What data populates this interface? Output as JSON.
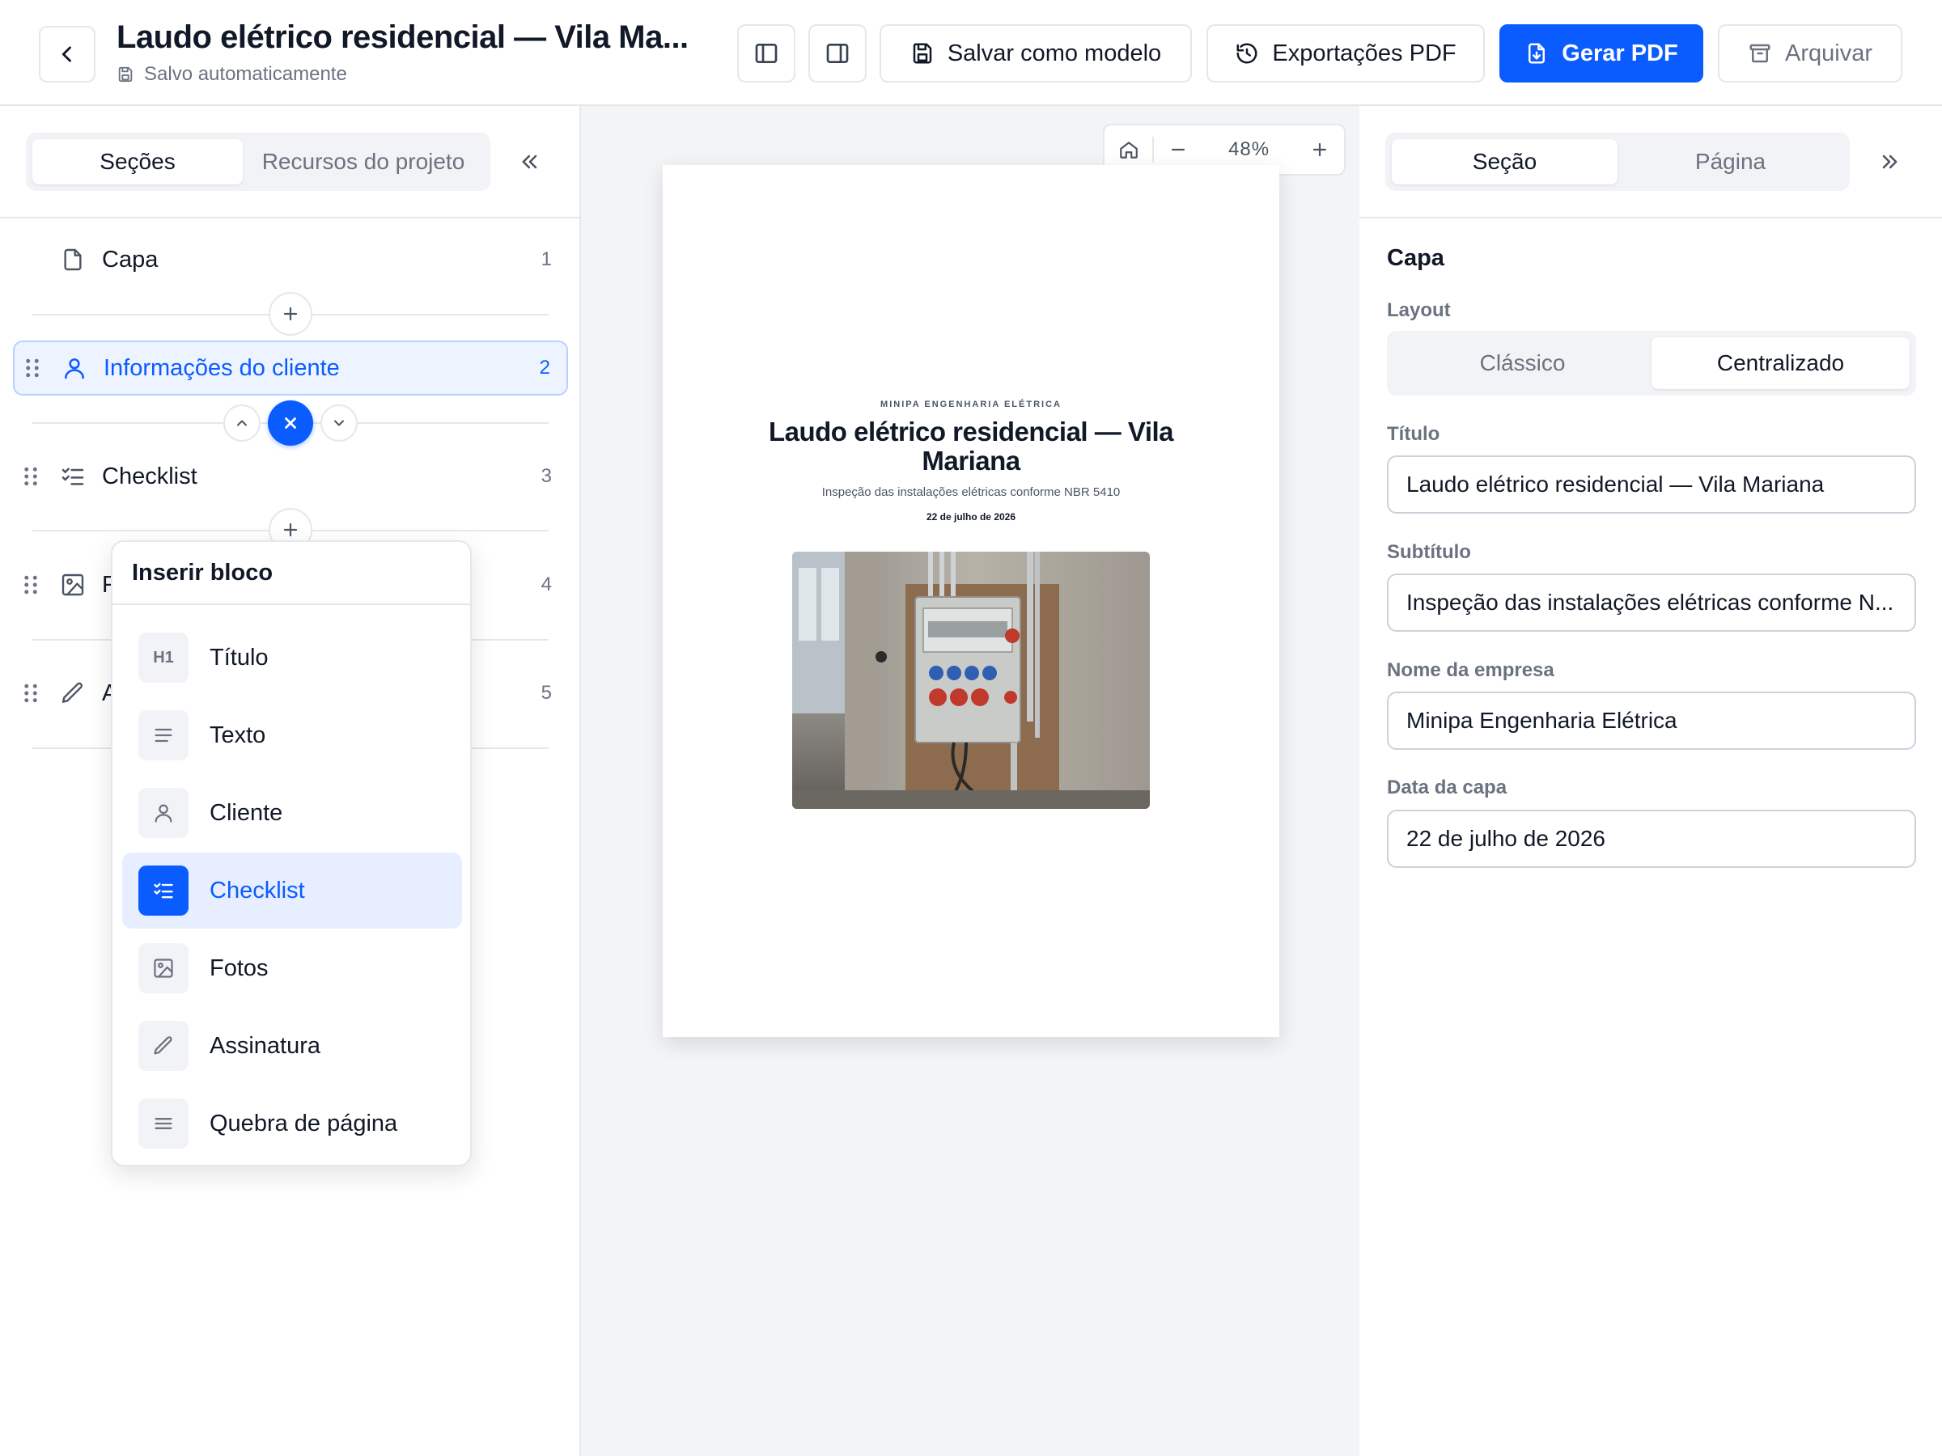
{
  "header": {
    "title": "Laudo elétrico residencial — Vila Ma...",
    "autosave": "Salvo automaticamente",
    "buttons": {
      "save_template": "Salvar como modelo",
      "exports": "Exportações PDF",
      "generate": "Gerar PDF",
      "archive": "Arquivar"
    }
  },
  "left": {
    "tabs": [
      "Seções",
      "Recursos do projeto"
    ],
    "sections": [
      {
        "label": "Capa",
        "num": "1",
        "icon": "file-icon"
      },
      {
        "label": "Informações do cliente",
        "num": "2",
        "icon": "user-icon"
      },
      {
        "label": "Checklist",
        "num": "3",
        "icon": "checklist-icon"
      },
      {
        "label": "F",
        "num": "4",
        "icon": "image-icon"
      },
      {
        "label": "A",
        "num": "5",
        "icon": "pencil-icon"
      }
    ],
    "active_section": 1
  },
  "menu": {
    "title": "Inserir bloco",
    "heading_glyph": "H1",
    "items": [
      {
        "label": "Título",
        "icon": "heading-icon"
      },
      {
        "label": "Texto",
        "icon": "text-lines-icon"
      },
      {
        "label": "Cliente",
        "icon": "user-icon"
      },
      {
        "label": "Checklist",
        "icon": "checklist-icon"
      },
      {
        "label": "Fotos",
        "icon": "image-icon"
      },
      {
        "label": "Assinatura",
        "icon": "pencil-icon"
      },
      {
        "label": "Quebra de página",
        "icon": "page-break-icon"
      }
    ],
    "active_item": 3
  },
  "canvas": {
    "zoom": "48%",
    "page": {
      "company": "MINIPA ENGENHARIA ELÉTRICA",
      "title": "Laudo elétrico residencial — Vila Mariana",
      "subtitle": "Inspeção das instalações elétricas conforme NBR 5410",
      "date": "22 de julho de 2026"
    }
  },
  "right": {
    "tabs": [
      "Seção",
      "Página"
    ],
    "heading": "Capa",
    "layout_label": "Layout",
    "layout_options": [
      "Clássico",
      "Centralizado"
    ],
    "layout_selected": "Centralizado",
    "fields": [
      {
        "label": "Título",
        "value": "Laudo elétrico residencial — Vila Mariana"
      },
      {
        "label": "Subtítulo",
        "value": "Inspeção das instalações elétricas conforme N..."
      },
      {
        "label": "Nome da empresa",
        "value": "Minipa Engenharia Elétrica"
      },
      {
        "label": "Data da capa",
        "value": "22 de julho de 2026"
      }
    ]
  },
  "colors": {
    "accent": "#0b5cff",
    "accent_light": "#e6eeff",
    "border": "#e5e7eb",
    "text": "#111827",
    "muted": "#6b7280"
  }
}
